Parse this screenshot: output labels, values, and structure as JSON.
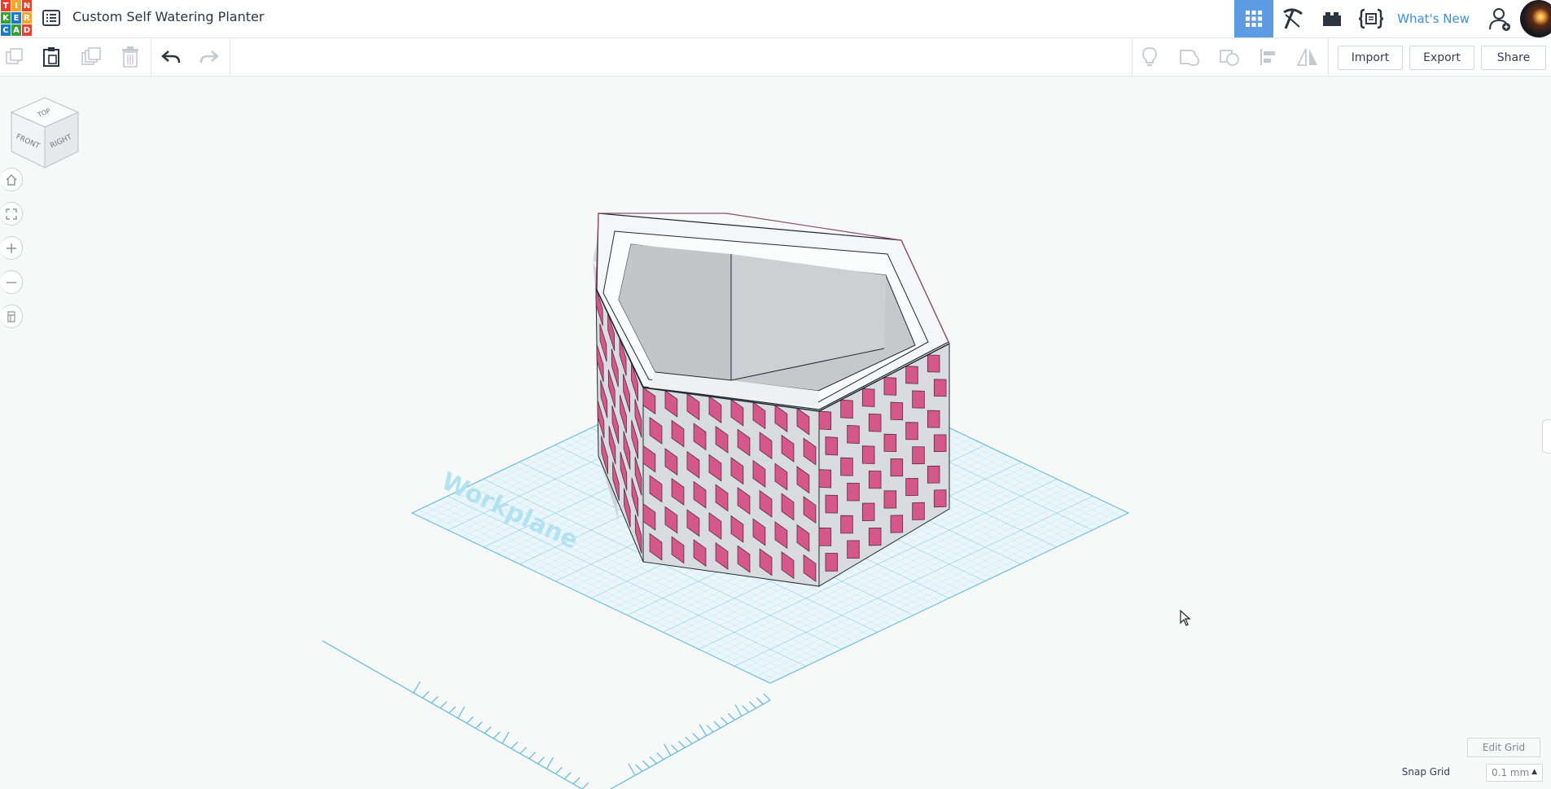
{
  "app": {
    "logo_letters": [
      "T",
      "I",
      "N",
      "K",
      "E",
      "R",
      "C",
      "A",
      "D"
    ],
    "logo_colors": [
      "#e5412e",
      "#f7a62b",
      "#e5412e",
      "#3a9f3b",
      "#1f78c7",
      "#f7a62b",
      "#1f78c7",
      "#3a9f3b",
      "#e5412e"
    ],
    "design_title": "Custom Self Watering Planter",
    "accent_color": "#5d9be3"
  },
  "topbar": {
    "views": [
      {
        "name": "3d-design-view",
        "icon": "grid-icon",
        "active": true
      },
      {
        "name": "blocks-view",
        "icon": "pickaxe-icon",
        "active": false
      },
      {
        "name": "bricks-view",
        "icon": "brick-icon",
        "active": false
      },
      {
        "name": "codeblocks-view",
        "icon": "code-braces-icon",
        "active": false
      }
    ],
    "whats_new": "What's New"
  },
  "toolbar": {
    "import_label": "Import",
    "export_label": "Export",
    "share_label": "Share"
  },
  "viewcube": {
    "top": "TOP",
    "front": "FRONT",
    "right": "RIGHT"
  },
  "workplane": {
    "label": "Workplane",
    "grid_color": "#7ccbe8",
    "model_color": "#d6578a"
  },
  "grid_controls": {
    "edit_grid": "Edit Grid",
    "snap_grid_label": "Snap Grid",
    "snap_grid_value": "0.1 mm"
  }
}
